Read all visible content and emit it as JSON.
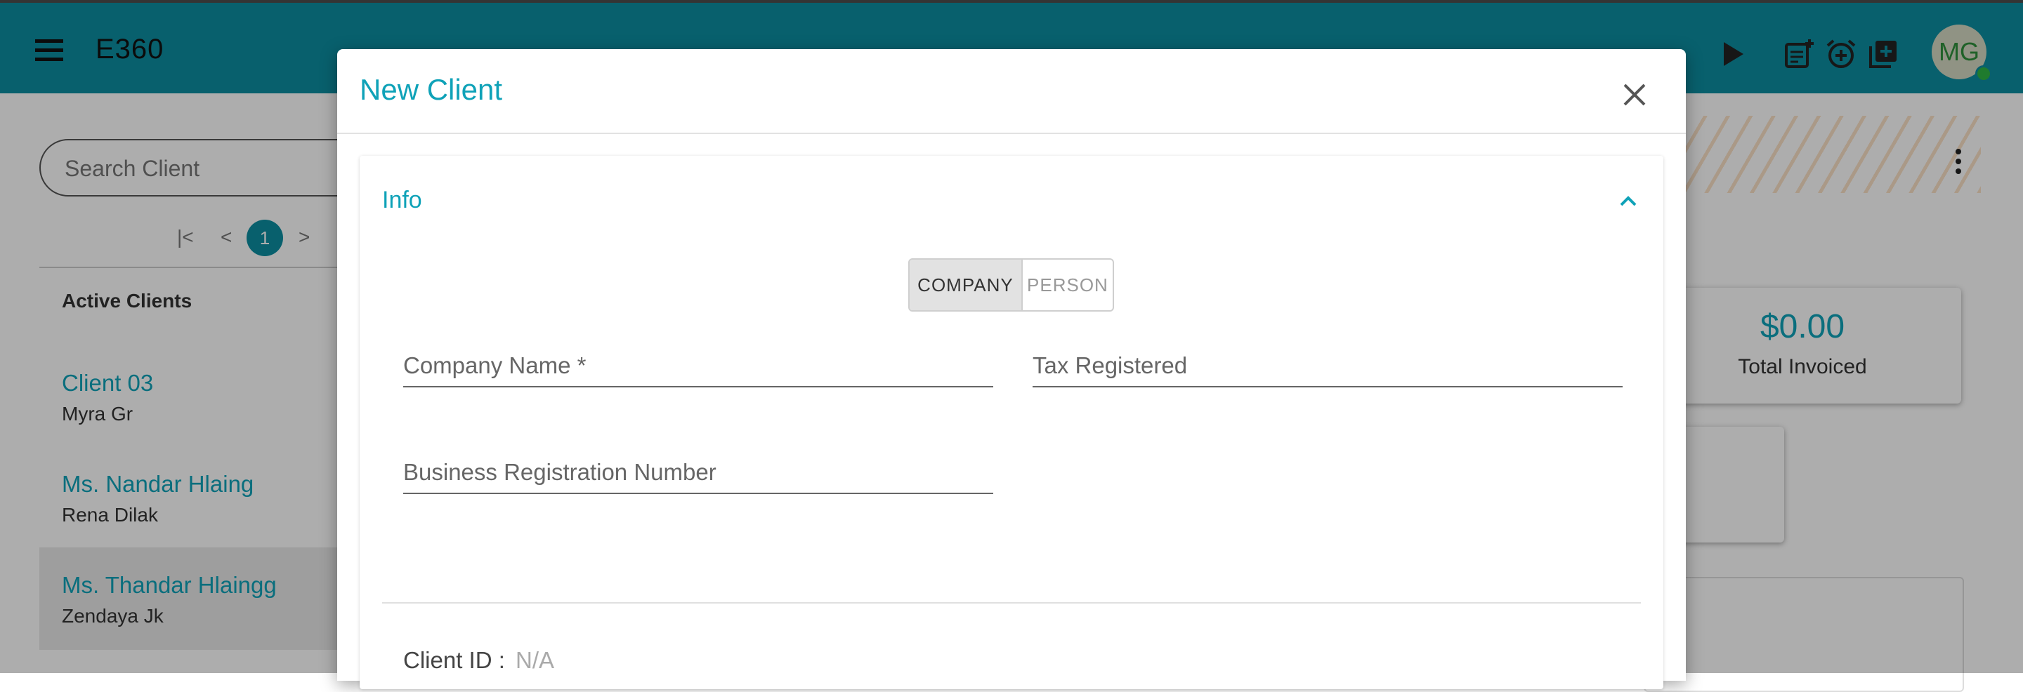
{
  "app": {
    "title": "E360",
    "avatar_initials": "MG"
  },
  "topbar": {
    "icons": [
      "menu-icon",
      "play-icon",
      "add-note-icon",
      "add-alarm-icon",
      "add-box-icon"
    ]
  },
  "sidebar": {
    "search_placeholder": "Search Client",
    "pagination": {
      "current_page": "1"
    },
    "list_header": "Active Clients",
    "clients": [
      {
        "name": "Client 03",
        "contact": "Myra Gr"
      },
      {
        "name": "Ms. Nandar Hlaing",
        "contact": "Rena Dilak"
      },
      {
        "name": "Ms. Thandar Hlaingg",
        "contact": "Zendaya Jk"
      }
    ]
  },
  "summary": {
    "total_invoiced_value": "$0.00",
    "total_invoiced_label": "Total Invoiced"
  },
  "modal": {
    "title": "New Client",
    "section_title": "Info",
    "client_type": {
      "options": [
        "COMPANY",
        "PERSON"
      ],
      "selected": "COMPANY"
    },
    "fields": {
      "company_name_placeholder": "Company Name *",
      "tax_registered_placeholder": "Tax Registered",
      "business_reg_placeholder": "Business Registration Number"
    },
    "client_id_label": "Client ID :",
    "client_id_value": "N/A"
  },
  "colors": {
    "brand": "#0d8ea1",
    "accent": "#0fa2b8",
    "online": "#2fb545"
  }
}
